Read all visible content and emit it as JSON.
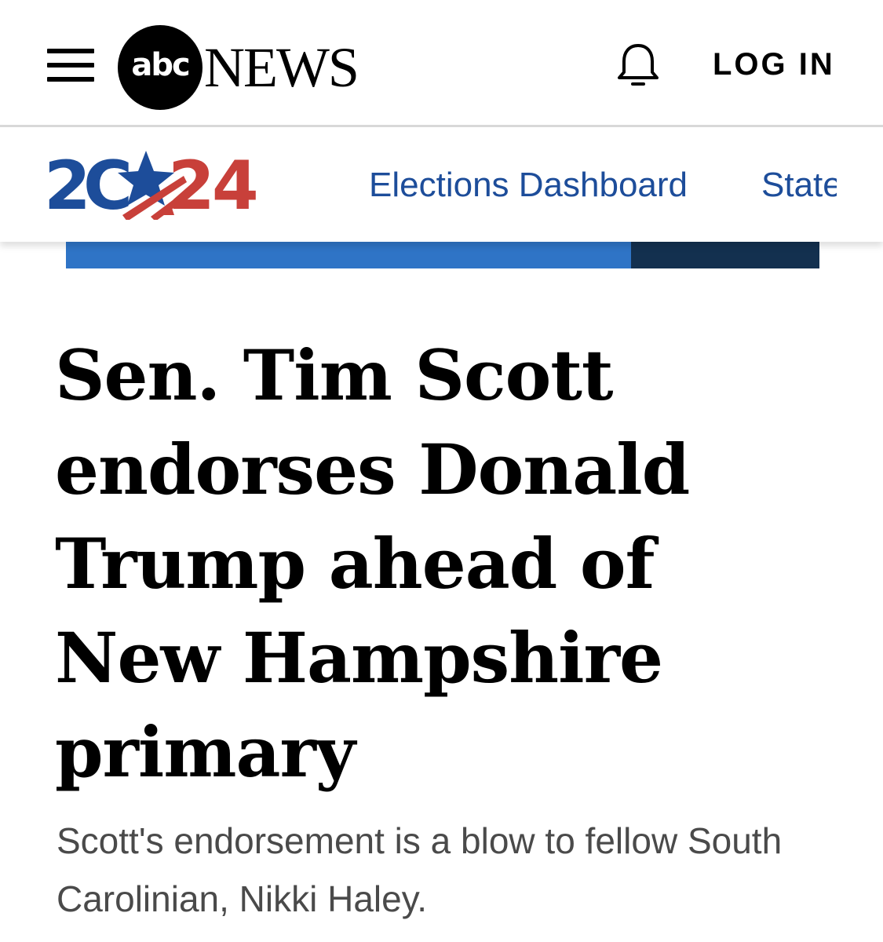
{
  "header": {
    "brand_mark": "abc",
    "brand_name": "NEWS",
    "login_label": "LOG IN",
    "icons": [
      "hamburger-menu-icon",
      "bell-icon"
    ]
  },
  "election_nav": {
    "logo_text": "2024",
    "links": [
      {
        "label": "Elections Dashboard"
      },
      {
        "label": "State"
      }
    ],
    "colors": {
      "blue": "#1d4d9a",
      "red": "#c8403a"
    }
  },
  "article": {
    "headline": "Sen. Tim Scott endorses Donald Trump ahead of New Hampshire primary",
    "subheadline": "Scott's endorsement is a blow to fellow South Carolinian, Nikki Haley."
  }
}
